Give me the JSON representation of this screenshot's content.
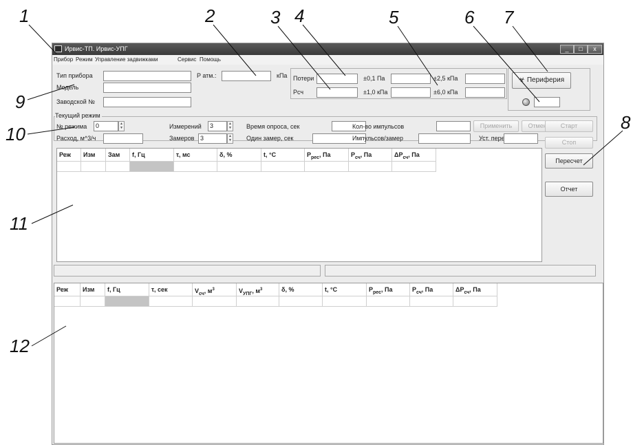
{
  "callouts": [
    "1",
    "2",
    "3",
    "4",
    "5",
    "6",
    "7",
    "8",
    "9",
    "10",
    "11",
    "12"
  ],
  "window": {
    "title": "Ирвис-ТП. Ирвис-УПГ",
    "minimize": "_",
    "maximize": "□",
    "close": "x"
  },
  "menu": [
    "Прибор",
    "Режим",
    "Управление задвижками",
    "Сервис",
    "Помощь"
  ],
  "device": {
    "type_label": "Тип прибора",
    "type_value": "",
    "model_label": "Модель",
    "model_value": "",
    "serial_label": "Заводской №",
    "serial_value": "",
    "patm_label": "P атм.:",
    "patm_value": "",
    "patm_unit": "кПа"
  },
  "sensors": {
    "loss_label": "Потери",
    "loss_value": "",
    "pcch_label": "Pсч",
    "pcch_value": "",
    "r1_label": "±0,1 Па",
    "r1_value": "",
    "r2_label": "±1,0 кПа",
    "r2_value": "",
    "r3_label": "±2,5 кПа",
    "r3_value": "",
    "r4_label": "±6,0 кПа",
    "r4_value": ""
  },
  "periphery": {
    "button_label": "Периферия",
    "status_value": ""
  },
  "mode": {
    "group_label": "Текущий режим",
    "mode_no_label": "№ режима",
    "mode_no_value": "0",
    "flow_label": "Расход, м^3/ч",
    "flow_value": "",
    "measurements_label": "Измерений",
    "measurements_value": "3",
    "samples_label": "Замеров",
    "samples_value": "3",
    "poll_time_label": "Время опроса, сек",
    "poll_time_value": "",
    "one_sample_label": "Один замер, сек",
    "one_sample_value": "",
    "pulses_label": "Кол-во импульсов",
    "pulses_value": "",
    "pulses_per_label": "Импульсов/замер",
    "pulses_per_value": "",
    "diff_label": "Уст. перепад",
    "diff_value": "",
    "apply_label": "Применить",
    "cancel_label": "Отменить"
  },
  "controls": {
    "start": "Старт",
    "stop": "Стоп",
    "recalc": "Пересчет",
    "report": "Отчет"
  },
  "table1": {
    "columns": [
      {
        "main": "Реж",
        "sub": ""
      },
      {
        "main": "Изм",
        "sub": ""
      },
      {
        "main": "Зам",
        "sub": ""
      },
      {
        "main": "f, Гц",
        "sub": ""
      },
      {
        "main": "τ, мс",
        "sub": ""
      },
      {
        "main": "δ, %",
        "sub": ""
      },
      {
        "main": "t, °C",
        "sub": ""
      },
      {
        "main": "P",
        "sub": "рес",
        "tail": ", Па"
      },
      {
        "main": "P",
        "sub": "сч",
        "tail": ", Па"
      },
      {
        "main": "ΔP",
        "sub": "сч",
        "tail": ", Па"
      }
    ]
  },
  "table2": {
    "columns": [
      {
        "main": "Реж",
        "sub": ""
      },
      {
        "main": "Изм",
        "sub": ""
      },
      {
        "main": "f, Гц",
        "sub": ""
      },
      {
        "main": "τ, сек",
        "sub": ""
      },
      {
        "main": "V",
        "sub": "сч",
        "tail": ", м",
        "sup": "3"
      },
      {
        "main": "V",
        "sub": "УПГ",
        "tail": ", м",
        "sup": "3"
      },
      {
        "main": "δ, %",
        "sub": ""
      },
      {
        "main": "t, °C",
        "sub": ""
      },
      {
        "main": "P",
        "sub": "рес",
        "tail": ", Па"
      },
      {
        "main": "P",
        "sub": "сч",
        "tail": ", Па"
      },
      {
        "main": "ΔP",
        "sub": "сч",
        "tail": ", Па"
      }
    ]
  }
}
